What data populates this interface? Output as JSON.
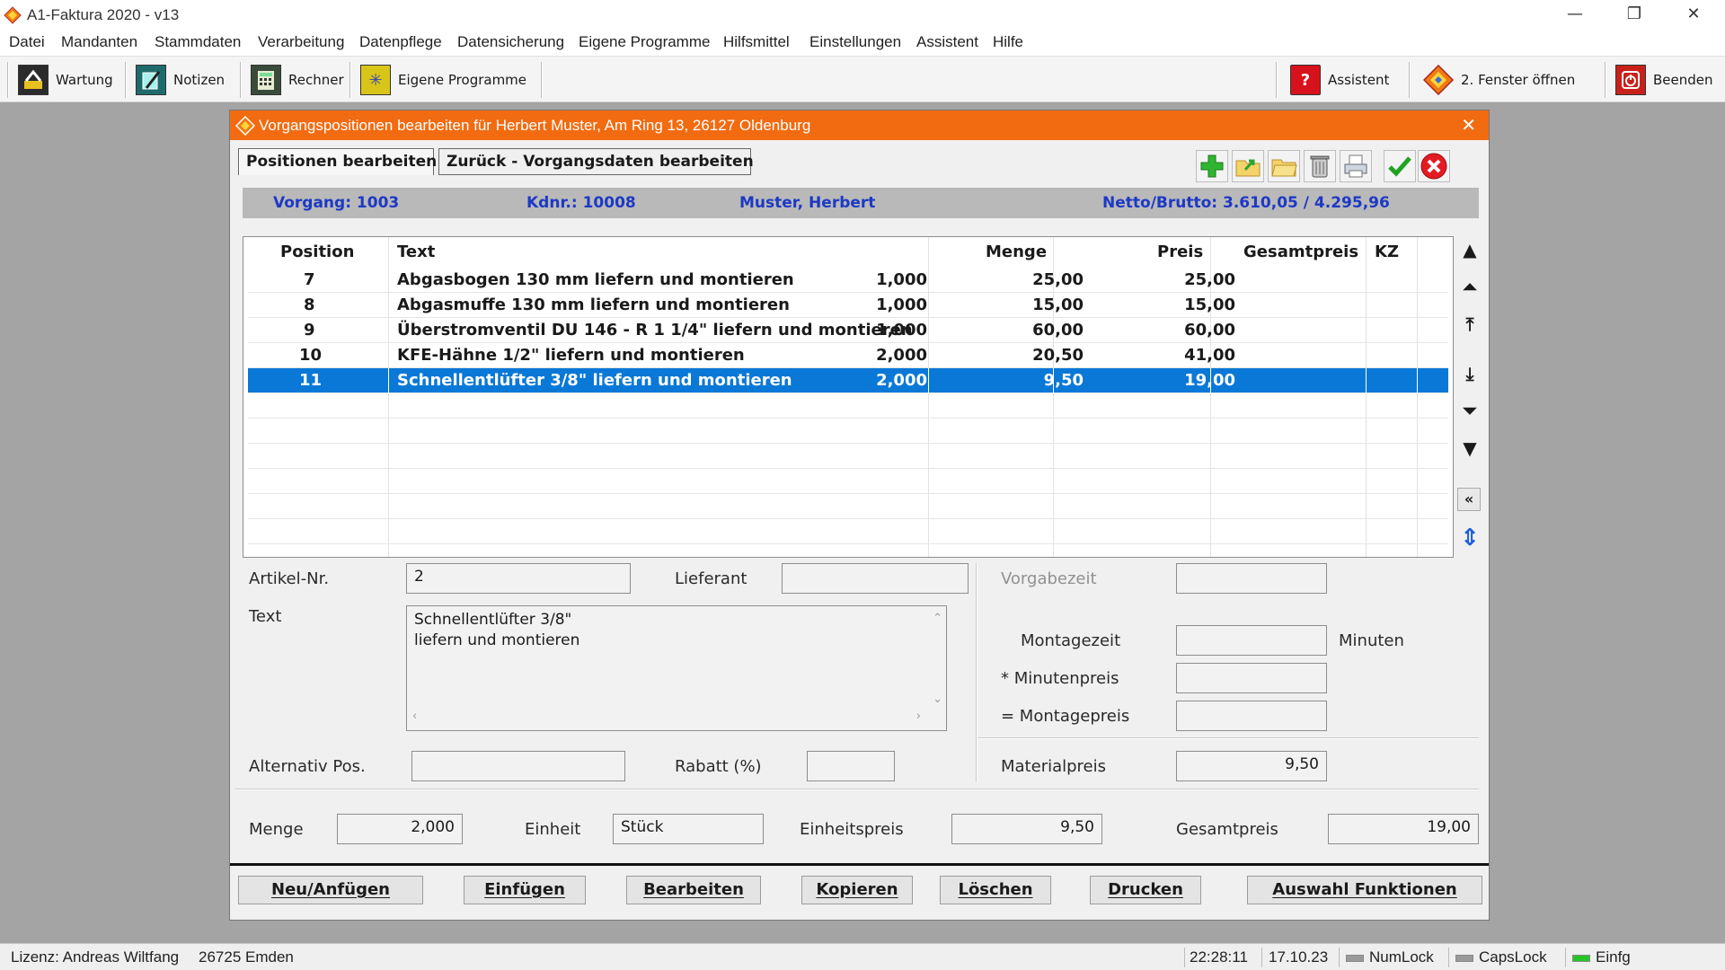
{
  "app": {
    "title": "A1-Faktura 2020 - v13"
  },
  "window_controls": {
    "minimize": "—",
    "restore": "❐",
    "close": "✕"
  },
  "menu": [
    "Datei",
    "Mandanten",
    "Stammdaten",
    "Verarbeitung",
    "Datenpflege",
    "Datensicherung",
    "Eigene Programme",
    "Hilfsmittel",
    "Einstellungen",
    "Assistent",
    "Hilfe"
  ],
  "toolbar": {
    "wartung": "Wartung",
    "notizen": "Notizen",
    "rechner": "Rechner",
    "eigene": "Eigene Programme",
    "assistent": "Assistent",
    "fenster": "2. Fenster öffnen",
    "beenden": "Beenden"
  },
  "dialog": {
    "title": "Vorgangspositionen bearbeiten für Herbert Muster, Am Ring 13, 26127 Oldenburg",
    "tab_positions": "Positionen bearbeiten",
    "tab_back": "Zurück - Vorgangsdaten bearbeiten",
    "info": {
      "vorgang": "Vorgang:  1003",
      "kdnr": "Kdnr.:  10008",
      "name": "Muster, Herbert",
      "netto_brutto": "Netto/Brutto:  3.610,05 / 4.295,96"
    }
  },
  "table": {
    "headers": {
      "position": "Position",
      "text": "Text",
      "menge": "Menge",
      "preis": "Preis",
      "gesamtpreis": "Gesamtpreis",
      "kz": "KZ"
    },
    "rows": [
      {
        "pos": "7",
        "text": "Abgasbogen 130 mm liefern und montieren",
        "menge": "1,000",
        "preis": "25,00",
        "gesamt": "25,00"
      },
      {
        "pos": "8",
        "text": "Abgasmuffe 130 mm liefern und montieren",
        "menge": "1,000",
        "preis": "15,00",
        "gesamt": "15,00"
      },
      {
        "pos": "9",
        "text": "Überstromventil DU 146 - R 1 1/4\" liefern und montieren",
        "menge": "1,000",
        "preis": "60,00",
        "gesamt": "60,00"
      },
      {
        "pos": "10",
        "text": "KFE-Hähne 1/2\" liefern und montieren",
        "menge": "2,000",
        "preis": "20,50",
        "gesamt": "41,00"
      },
      {
        "pos": "11",
        "text": "Schnellentlüfter 3/8\" liefern und montieren",
        "menge": "2,000",
        "preis": "9,50",
        "gesamt": "19,00"
      }
    ],
    "selected_index": 4
  },
  "nav": {
    "up": "▲",
    "top_step": "⏶",
    "first": "⤒",
    "last": "⤓",
    "down_step": "⏷",
    "down": "▼",
    "collapse": "«",
    "updown": "⇕"
  },
  "form": {
    "artikel_label": "Artikel-Nr.",
    "artikel_value": "2",
    "lieferant_label": "Lieferant",
    "lieferant_value": "",
    "text_label": "Text",
    "text_line1": "Schnellentlüfter 3/8\"",
    "text_line2": "liefern und montieren",
    "vorgabe_label": "Vorgabezeit",
    "montagezeit_label": "Montagezeit",
    "minuten_unit": "Minuten",
    "minutenpreis_label": "* Minutenpreis",
    "montagepreis_label": "= Montagepreis",
    "alternativ_label": "Alternativ Pos.",
    "rabatt_label": "Rabatt (%)",
    "materialpreis_label": "Materialpreis",
    "materialpreis_value": "9,50",
    "menge_label": "Menge",
    "menge_value": "2,000",
    "einheit_label": "Einheit",
    "einheit_value": "Stück",
    "einheitspreis_label": "Einheitspreis",
    "einheitspreis_value": "9,50",
    "gesamtpreis_label": "Gesamtpreis",
    "gesamtpreis_value": "19,00"
  },
  "buttons": {
    "neu": "Neu/Anfügen",
    "einfuegen": "Einfügen",
    "bearbeiten": "Bearbeiten",
    "kopieren": "Kopieren",
    "loeschen": "Löschen",
    "drucken": "Drucken",
    "auswahl": "Auswahl Funktionen"
  },
  "status": {
    "lizenz": "Lizenz: Andreas Wiltfang",
    "ort": "26725 Emden",
    "time": "22:28:11",
    "date": "17.10.23",
    "numlock": "NumLock",
    "capslock": "CapsLock",
    "einfg": "Einfg"
  },
  "colors": {
    "accent": "#f26b11",
    "selection": "#0a78d7",
    "info_text": "#1d39c4"
  }
}
